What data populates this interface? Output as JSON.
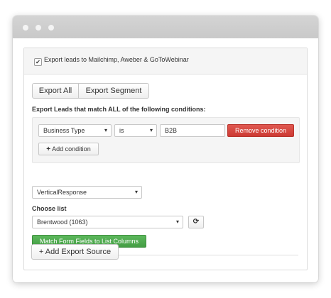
{
  "window": {
    "controls": [
      "close",
      "minimize",
      "maximize"
    ]
  },
  "export_panel": {
    "enabled": true,
    "checkbox_label": "Export leads to Mailchimp, Aweber & GoToWebinar",
    "mode_buttons": {
      "all": "Export All",
      "segment": "Export Segment"
    },
    "conditions_heading": "Export Leads that match ALL of the following conditions:",
    "condition": {
      "field": "Business Type",
      "operator": "is",
      "value": "B2B",
      "remove_label": "Remove condition"
    },
    "add_condition_label": "Add condition",
    "add_condition_icon": "plus-icon",
    "service_select": "VerticalResponse",
    "choose_list_label": "Choose list",
    "list_select": "Brentwood (1063)",
    "refresh_icon": "refresh-icon",
    "match_fields_label": "Match Form Fields to List Columns",
    "add_source_label": "+ Add Export Source"
  },
  "colors": {
    "danger": "#d9453e",
    "success": "#4cae4c",
    "panel_header": "#f5f5f5",
    "titlebar": "#cfcfcf"
  }
}
